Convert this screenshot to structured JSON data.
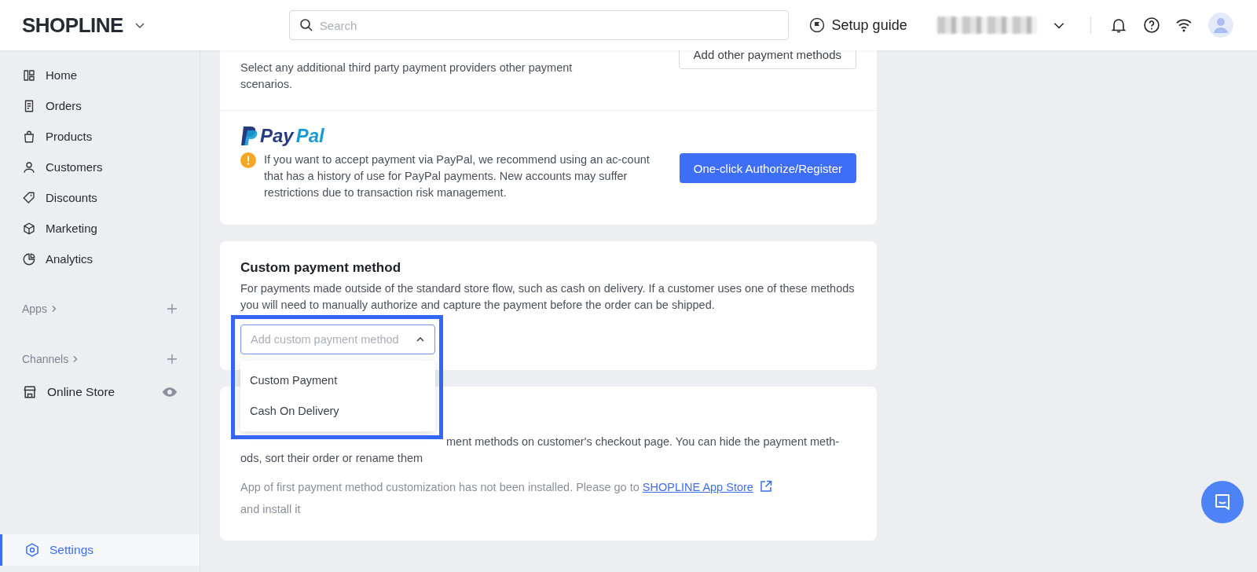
{
  "header": {
    "logo": "SHOPLINE",
    "search": {
      "placeholder": "Search"
    },
    "setup_guide": "Setup guide"
  },
  "sidebar": {
    "items": [
      {
        "label": "Home",
        "selected": false
      },
      {
        "label": "Orders",
        "selected": false
      },
      {
        "label": "Products",
        "selected": false
      },
      {
        "label": "Customers",
        "selected": false
      },
      {
        "label": "Discounts",
        "selected": false
      },
      {
        "label": "Marketing",
        "selected": false
      },
      {
        "label": "Analytics",
        "selected": false
      }
    ],
    "sections": [
      {
        "label": "Apps"
      },
      {
        "label": "Channels",
        "items": [
          {
            "label": "Online Store"
          }
        ]
      }
    ],
    "settings": {
      "label": "Settings",
      "selected": true
    }
  },
  "other_payment_methods": {
    "description": "Select any additional third party payment providers other payment scenarios.",
    "button": "Add other payment methods"
  },
  "paypal": {
    "logo_part_1": "Pay",
    "logo_part_2": "Pal",
    "warning": "If you want to accept payment via PayPal, we recommend using an ac-count that has a history of use for PayPal payments. New accounts may suffer restrictions due to transaction risk management.",
    "button": "One-click Authorize/Register"
  },
  "custom_payment": {
    "title": "Custom payment method",
    "description": "For payments made outside of the standard store flow, such as cash on delivery. If a customer uses one of these methods you will need to manually authorize and capture the payment before the order can be shipped.",
    "select": {
      "placeholder": "Add custom payment method",
      "expanded": true,
      "options": [
        "Custom Payment",
        "Cash On Delivery"
      ]
    }
  },
  "customization": {
    "description_visible_part": "ment methods on customer's checkout page. You can hide the payment meth-",
    "description_end": "ods, sort their order or rename them",
    "note": "App of first payment method customization has not been installed. Please go to",
    "link": "SHOPLINE App Store",
    "note_end": "and install it"
  }
}
